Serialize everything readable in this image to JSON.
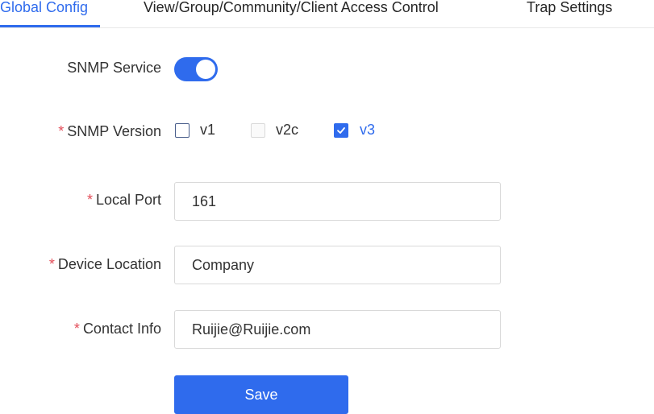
{
  "tabs": [
    {
      "label": "Global Config",
      "active": true
    },
    {
      "label": "View/Group/Community/Client Access Control",
      "active": false
    },
    {
      "label": "Trap Settings",
      "active": false
    }
  ],
  "form": {
    "snmp_service": {
      "label": "SNMP Service",
      "enabled": true
    },
    "snmp_version": {
      "label": "SNMP Version",
      "required_mark": "*",
      "options": [
        {
          "label": "v1",
          "checked": false,
          "disabled": false
        },
        {
          "label": "v2c",
          "checked": false,
          "disabled": true
        },
        {
          "label": "v3",
          "checked": true,
          "disabled": false
        }
      ]
    },
    "local_port": {
      "label": "Local Port",
      "required_mark": "*",
      "value": "161"
    },
    "device_location": {
      "label": "Device Location",
      "required_mark": "*",
      "value": "Company"
    },
    "contact_info": {
      "label": "Contact Info",
      "required_mark": "*",
      "value": "Ruijie@Ruijie.com"
    }
  },
  "actions": {
    "save_label": "Save"
  },
  "colors": {
    "accent": "#2f6bed",
    "required": "#e34d59"
  }
}
